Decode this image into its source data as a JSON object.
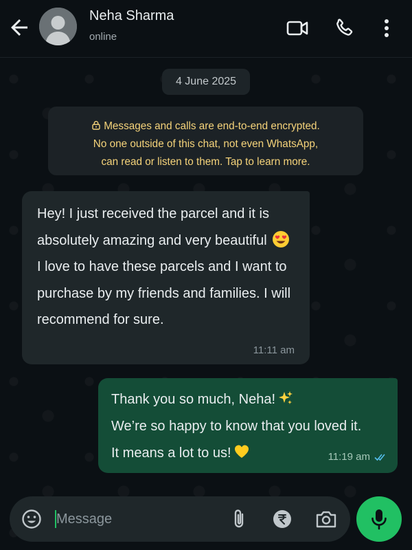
{
  "header": {
    "contact_name": "Neha Sharma",
    "status": "online",
    "icons": [
      "back-arrow-icon",
      "avatar",
      "video-call-icon",
      "phone-icon",
      "more-vert-icon"
    ]
  },
  "chat": {
    "date": "4 June 2025",
    "encryption_notice": {
      "line1": "Messages and calls are end-to-end encrypted.",
      "line2": "No one outside of this chat, not even WhatsApp,",
      "line3": "can read or listen to them. Tap to learn more."
    },
    "messages": [
      {
        "direction": "incoming",
        "text_part1": "Hey! I just received the parcel and it is absolutely amazing and very beautiful",
        "emoji": "smiling-face-with-heart-eyes",
        "text_part2": "I love to have these parcels and I want to purchase by my friends and families. I will recommend for sure.",
        "time": "11:11 am"
      },
      {
        "direction": "outgoing",
        "line1": "Thank you so much, Neha!",
        "line1_emoji": "sparkles",
        "line2": "We’re so happy to know that you loved it.",
        "line3": "It means a lot to us!",
        "line3_emoji": "yellow-heart",
        "time": "11:19 am",
        "read_receipt": "double-check-blue"
      }
    ]
  },
  "composer": {
    "placeholder": "Message"
  },
  "colors": {
    "background": "#0b1014",
    "incoming_bubble": "#1f272a",
    "outgoing_bubble": "#144d37",
    "accent": "#21c063",
    "notice_text": "#f5d37a"
  }
}
